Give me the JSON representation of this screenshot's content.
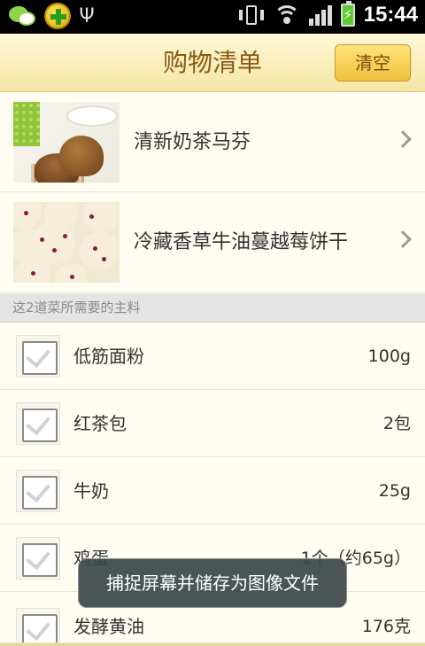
{
  "status_bar": {
    "time": "15:44",
    "icons": [
      "wechat-icon",
      "plus-icon",
      "usb-icon",
      "vibrate-icon",
      "wifi-icon",
      "signal-icon",
      "battery-charging-icon"
    ]
  },
  "header": {
    "title": "购物清单",
    "clear_label": "清空"
  },
  "recipes": [
    {
      "name": "清新奶茶马芬",
      "image": "muffin-photo"
    },
    {
      "name": "冷藏香草牛油蔓越莓饼干",
      "image": "cookie-photo"
    }
  ],
  "section": {
    "label": "这2道菜所需要的主料"
  },
  "ingredients": [
    {
      "name": "低筋面粉",
      "amount": "100g"
    },
    {
      "name": "红茶包",
      "amount": "2包"
    },
    {
      "name": "牛奶",
      "amount": "25g"
    },
    {
      "name": "鸡蛋",
      "amount": "1个（约65g）"
    },
    {
      "name": "发酵黄油",
      "amount": "176克"
    }
  ],
  "toast": {
    "message": "捕捉屏幕并储存为图像文件"
  },
  "colors": {
    "header_bg": "#f4e6a6",
    "title": "#8a5a12",
    "button": "#eec23c",
    "list_bg": "#fffdf2",
    "section_bg": "#e4e4e4"
  }
}
